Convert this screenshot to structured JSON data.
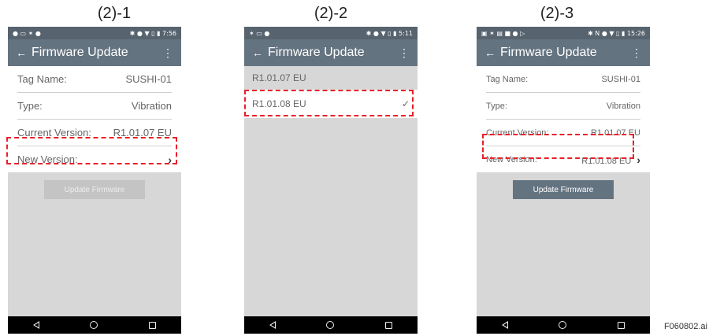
{
  "screens": [
    {
      "caption": "(2)-1",
      "status": {
        "left_icons": "● ▭ ✶ ●",
        "right_icons": "✱ ● ▼ ▯ ▮ 7:56"
      },
      "appbar": {
        "back": "←",
        "title": "Firmware Update",
        "menu": "⋮"
      },
      "rows": [
        {
          "label": "Tag Name:",
          "value": "SUSHI-01"
        },
        {
          "label": "Type:",
          "value": "Vibration"
        },
        {
          "label": "Current Version:",
          "value": "R1.01.07 EU"
        },
        {
          "label": "New Version:",
          "value": "",
          "chevron": "›"
        }
      ],
      "button": "Update Firmware"
    },
    {
      "caption": "(2)-2",
      "status": {
        "left_icons": "✶ ▭ ●",
        "right_icons": "✱ ● ▼ ▯ ▮ 5:11"
      },
      "appbar": {
        "back": "←",
        "title": "Firmware Update",
        "menu": "⋮"
      },
      "versions": [
        {
          "label": "R1.01.07 EU",
          "check": ""
        },
        {
          "label": "R1.01.08 EU",
          "check": "✓"
        }
      ]
    },
    {
      "caption": "(2)-3",
      "status": {
        "left_icons": "▣ ✶ ▤ ■ ● ▷",
        "right_icons": "✱ N ● ▼ ▯ ▮ 15:26"
      },
      "appbar": {
        "back": "←",
        "title": "Firmware Update",
        "menu": "⋮"
      },
      "rows": [
        {
          "label": "Tag Name:",
          "value": "SUSHI-01"
        },
        {
          "label": "Type:",
          "value": "Vibration"
        },
        {
          "label": "Current Version:",
          "value": "R1.01.07 EU"
        },
        {
          "label": "New Version:",
          "value": "R1.01.08 EU",
          "chevron": "›"
        }
      ],
      "button": "Update Firmware"
    }
  ],
  "footer_label": "F060802.ai",
  "colors": {
    "highlight": "#e8202a",
    "appbar": "#647380",
    "statusbar": "#57636e",
    "background": "#d7d7d7"
  }
}
